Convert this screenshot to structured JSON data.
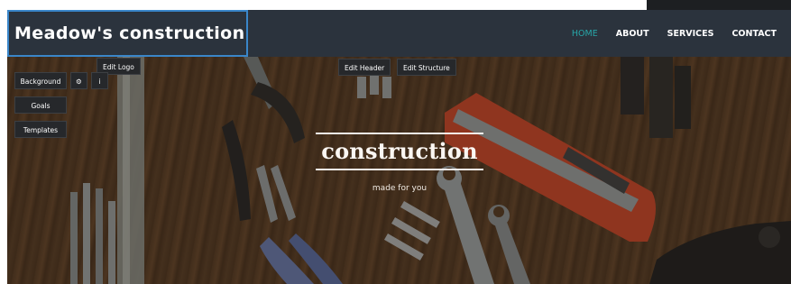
{
  "navbar": {
    "logo_text": "Meadow's construction",
    "links": [
      {
        "label": "HOME",
        "active": true
      },
      {
        "label": "ABOUT",
        "active": false
      },
      {
        "label": "SERVICES",
        "active": false
      },
      {
        "label": "CONTACT",
        "active": false
      }
    ]
  },
  "editor": {
    "edit_logo": "Edit Logo",
    "edit_header": "Edit Header",
    "edit_structure": "Edit Structure",
    "background": "Background",
    "goals": "Goals",
    "templates": "Templates",
    "info_icon_glyph": "i",
    "settings_icon_glyph": "⚙"
  },
  "hero": {
    "title": "construction",
    "subtitle": "made for you"
  },
  "colors": {
    "navbar_bg": "#2b333d",
    "active_link": "#27a6a8",
    "logo_border": "#3a86c9",
    "edit_button_bg": "#26282b"
  }
}
